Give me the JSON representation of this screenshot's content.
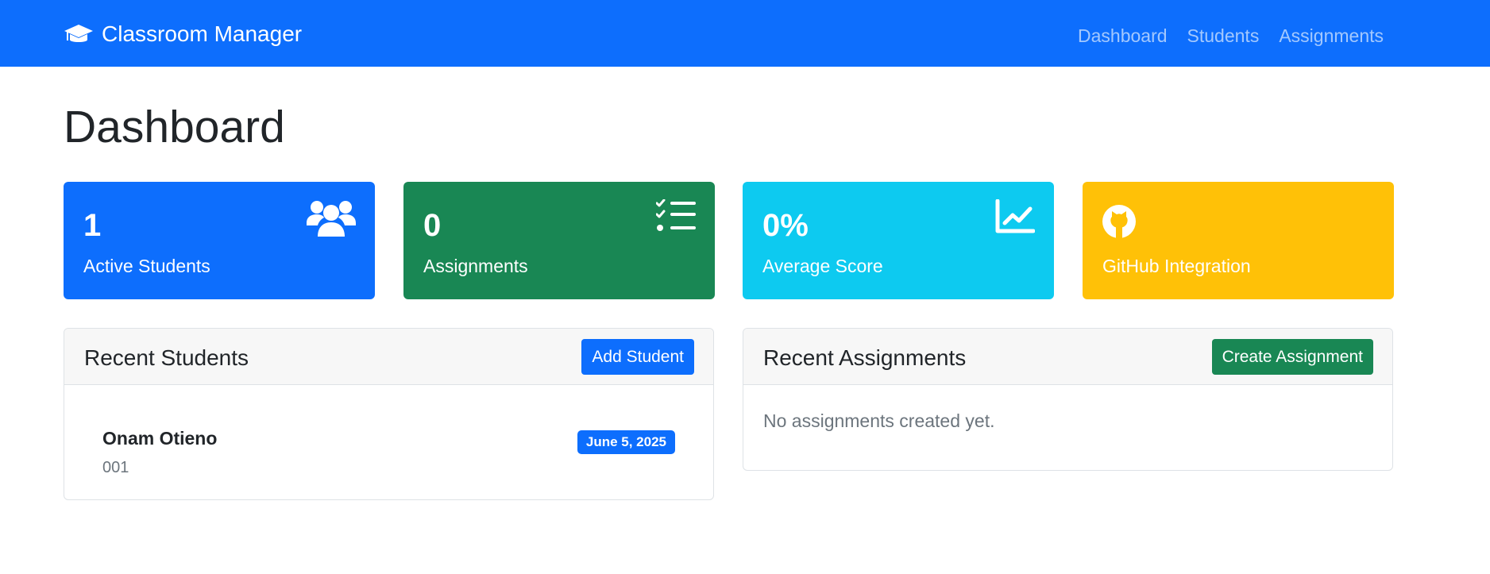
{
  "navbar": {
    "brand": "Classroom Manager",
    "brand_icon": "graduation-cap-icon",
    "links": [
      {
        "label": "Dashboard"
      },
      {
        "label": "Students"
      },
      {
        "label": "Assignments"
      }
    ],
    "background": "#0d6efd"
  },
  "page": {
    "title": "Dashboard"
  },
  "stats": [
    {
      "value": "1",
      "label": "Active Students",
      "icon": "users-icon",
      "color": "#0d6efd"
    },
    {
      "value": "0",
      "label": "Assignments",
      "icon": "task-list-icon",
      "color": "#198754"
    },
    {
      "value": "0%",
      "label": "Average Score",
      "icon": "chart-line-icon",
      "color": "#0dcaf0"
    },
    {
      "value": "",
      "label": "GitHub Integration",
      "icon": "github-icon",
      "color": "#ffc107"
    }
  ],
  "recent_students": {
    "title": "Recent Students",
    "button_label": "Add Student",
    "items": [
      {
        "name": "Onam Otieno",
        "id": "001",
        "date": "June 5, 2025"
      }
    ]
  },
  "recent_assignments": {
    "title": "Recent Assignments",
    "button_label": "Create Assignment",
    "empty_text": "No assignments created yet."
  }
}
